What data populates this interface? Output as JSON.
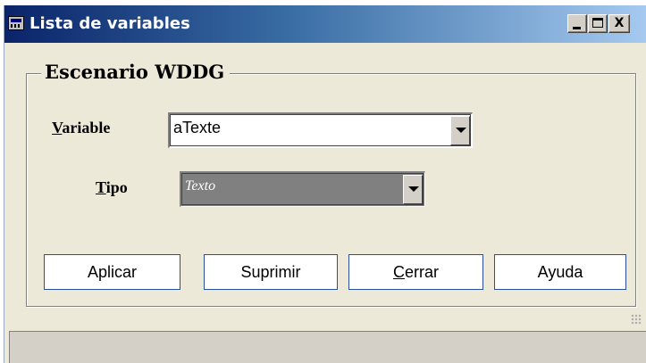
{
  "window": {
    "title": "Lista de variables",
    "icon": "app-window-icon",
    "controls": {
      "minimize": "_",
      "maximize": "□",
      "close": "X"
    }
  },
  "group": {
    "title": "Escenario WDDG"
  },
  "fields": {
    "variable": {
      "label_accel": "V",
      "label_rest": "ariable",
      "value": "aTexte"
    },
    "tipo": {
      "label_accel": "T",
      "label_rest": "ipo",
      "value": "Texto",
      "enabled": false
    }
  },
  "buttons": {
    "apply": "Aplicar",
    "delete": "Suprimir",
    "close_accel": "C",
    "close_rest": "errar",
    "help": "Ayuda"
  },
  "colors": {
    "titlebar_start": "#0a246a",
    "titlebar_end": "#a6caf0",
    "face": "#ece9d8",
    "button_border": "#2a4f9c",
    "disabled_field": "#808080"
  }
}
